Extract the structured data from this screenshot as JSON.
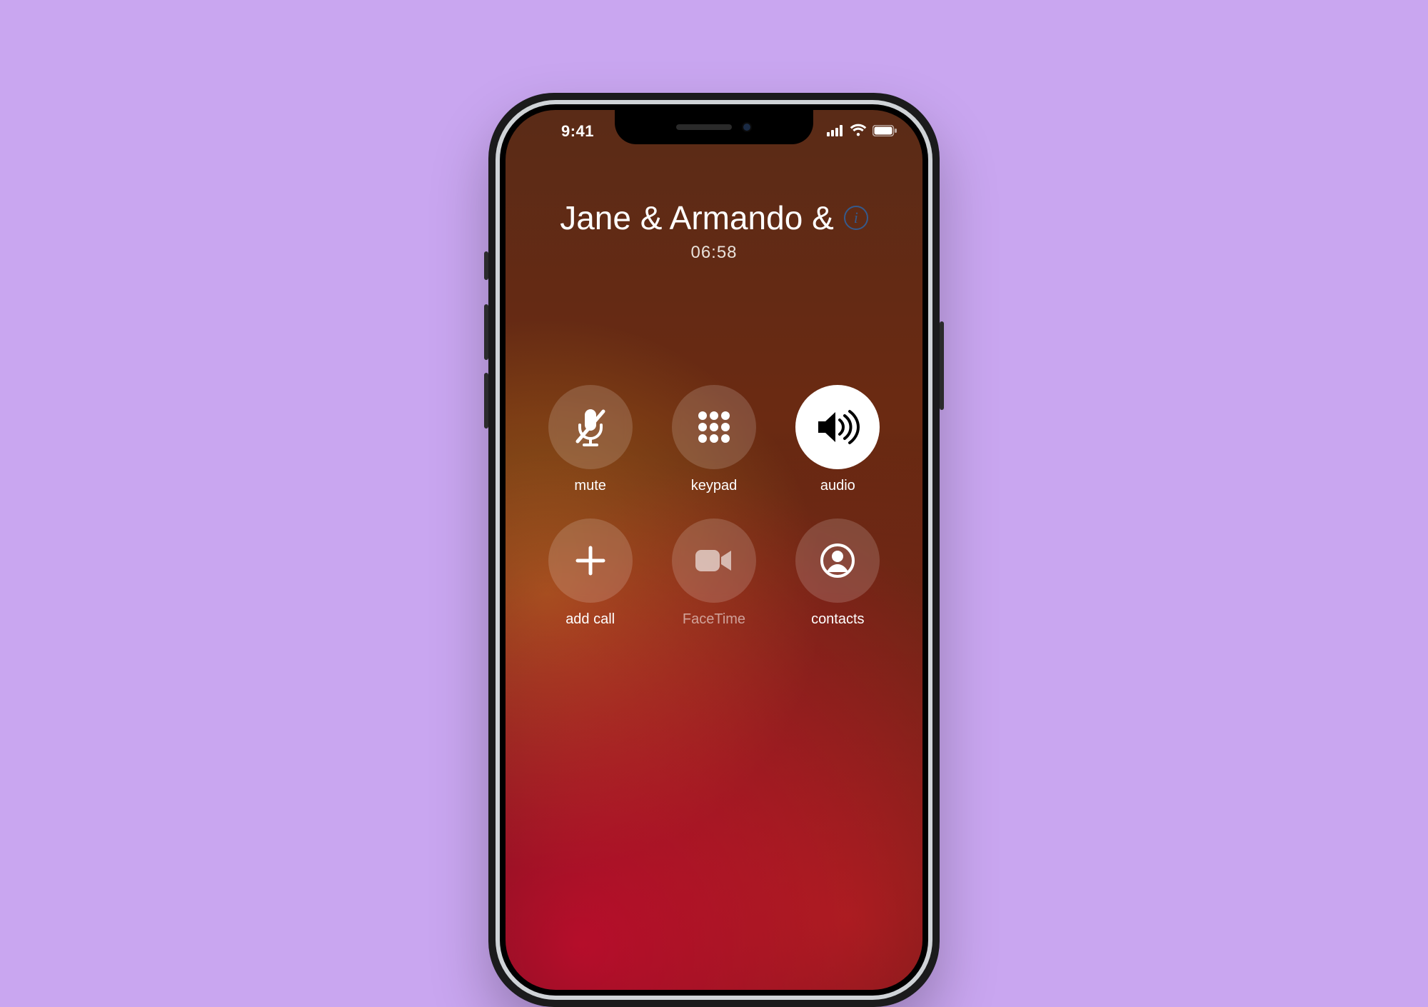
{
  "status": {
    "time": "9:41"
  },
  "call": {
    "title": "Jane & Armando &",
    "duration": "06:58"
  },
  "actions": {
    "mute": {
      "label": "mute"
    },
    "keypad": {
      "label": "keypad"
    },
    "audio": {
      "label": "audio"
    },
    "add_call": {
      "label": "add call"
    },
    "facetime": {
      "label": "FaceTime"
    },
    "contacts": {
      "label": "contacts"
    }
  }
}
